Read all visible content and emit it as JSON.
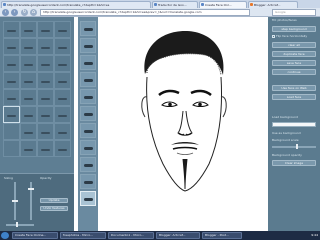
{
  "browser": {
    "tabs": [
      "http://translate.googleusercontent.com/translate_c?depth=1&hl=es",
      "Traductor de Goo...",
      "Create Face Onl...",
      "Blogger: Artcraf..."
    ],
    "url": "http://translate.googleusercontent.com/translate_c?depth=1&hl=es&prev=_t&rurl=translate.google.com",
    "search_placeholder": "Google"
  },
  "left_panel": {
    "controls": {
      "sizing_label": "Sizing",
      "opacity_label": "Opacity",
      "button_1": "Update",
      "button_2": "Undo features"
    }
  },
  "right_panel": {
    "header": "fill: photos/faces",
    "buttons": [
      "step background",
      "clear all",
      "duplicate face",
      "save face",
      "continue",
      "Use face on Web",
      "Load face"
    ],
    "checkbox_label": "Flip face horizontally",
    "load_background_label": "Load background",
    "use_as_background_label": "Use as background",
    "background_scale_label": "Background scale",
    "background_opacity_label": "Background opacity",
    "clear_image_button": "Clear image"
  },
  "taskbar": {
    "items": [
      "Create Face Online...",
      "freephotos - Micro...",
      "Documento1 - Micro...",
      "Blogger: Artcraf...",
      "Blogger - Post..."
    ],
    "clock": "9:44"
  }
}
